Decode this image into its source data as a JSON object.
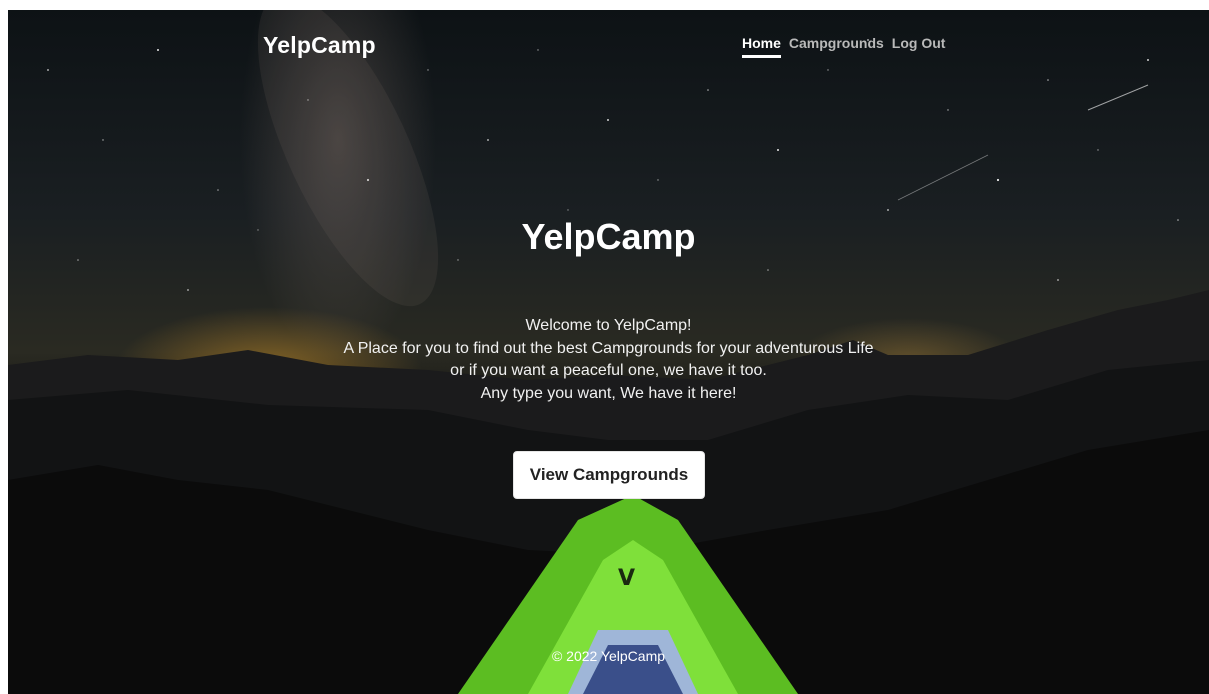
{
  "navbar": {
    "brand": "YelpCamp",
    "links": [
      {
        "label": "Home",
        "active": true
      },
      {
        "label": "Campgrounds",
        "active": false
      },
      {
        "label": "Log Out",
        "active": false
      }
    ]
  },
  "hero": {
    "title": "YelpCamp",
    "lines": [
      "Welcome to YelpCamp!",
      "A Place for you to find out the best Campgrounds for your adventurous Life",
      "or if you want a peaceful one, we have it too.",
      "Any type you want, We have it here!"
    ],
    "button_label": "View Campgrounds"
  },
  "footer": {
    "text": "© 2022 YelpCamp"
  },
  "colors": {
    "text": "#ffffff",
    "muted_link": "#b9b9b9",
    "tent_green": "#6fd42a"
  }
}
